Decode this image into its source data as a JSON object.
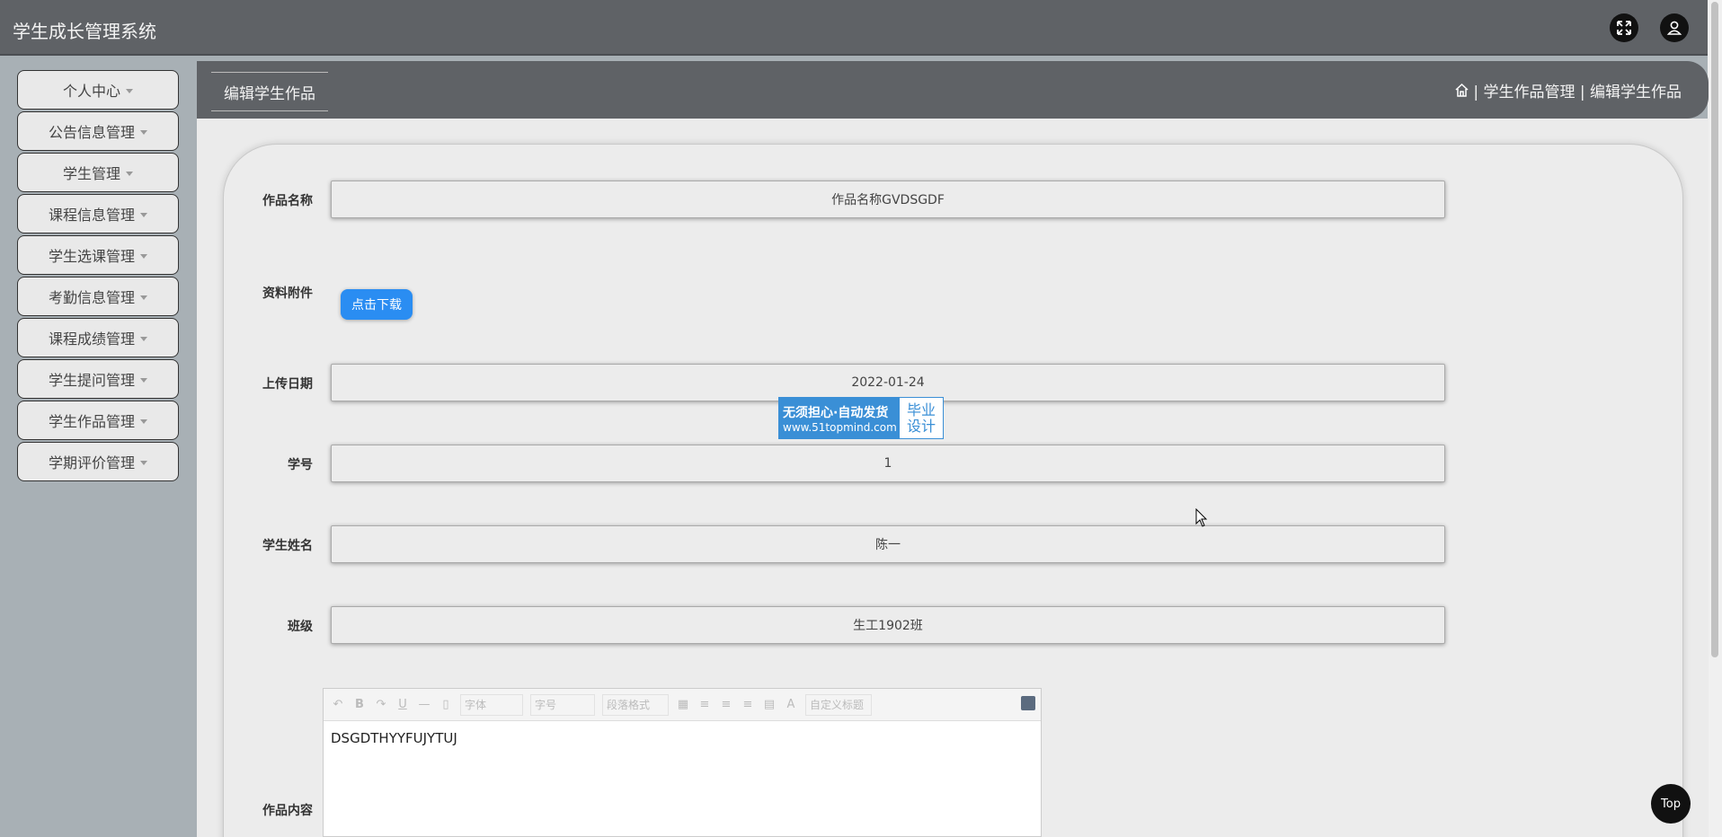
{
  "app": {
    "title": "学生成长管理系统"
  },
  "sidebar": {
    "items": [
      {
        "label": "个人中心"
      },
      {
        "label": "公告信息管理"
      },
      {
        "label": "学生管理"
      },
      {
        "label": "课程信息管理"
      },
      {
        "label": "学生选课管理"
      },
      {
        "label": "考勤信息管理"
      },
      {
        "label": "课程成绩管理"
      },
      {
        "label": "学生提问管理"
      },
      {
        "label": "学生作品管理"
      },
      {
        "label": "学期评价管理"
      }
    ]
  },
  "breadcrumb": {
    "tab": "编辑学生作品",
    "trail": " | 学生作品管理 | 编辑学生作品"
  },
  "form": {
    "name_label": "作品名称",
    "name_value": "作品名称GVDSGDF",
    "attachment_label": "资料附件",
    "download_label": "点击下载",
    "date_label": "上传日期",
    "date_value": "2022-01-24",
    "student_no_label": "学号",
    "student_no_value": "1",
    "student_name_label": "学生姓名",
    "student_name_value": "陈一",
    "class_label": "班级",
    "class_value": "生工1902班",
    "content_label": "作品内容",
    "content_value": "DSGDTHYYFUJYTUJ"
  },
  "editor": {
    "font_select": "字体",
    "size_select": "字号",
    "para_select": "段落格式",
    "custom_title_select": "自定义标题",
    "text_color_label": "A"
  },
  "watermark": {
    "line1": "无须担心·自动发货",
    "line2": "www.51topmind.com",
    "right1": "毕业",
    "right2": "设计"
  },
  "back_to_top": "Top"
}
